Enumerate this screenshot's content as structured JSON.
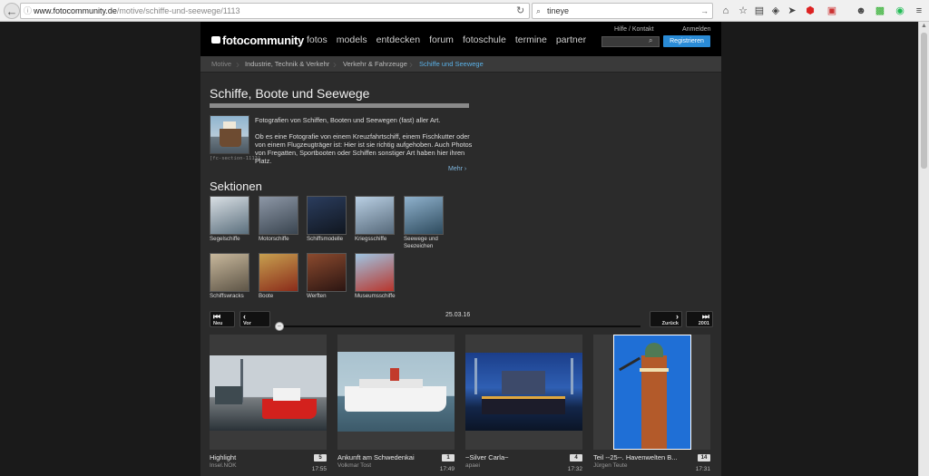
{
  "browser": {
    "url_host": "www.fotocommunity.de",
    "url_path": "/motive/schiffe-und-seewege/1113",
    "search_value": "tineye"
  },
  "header": {
    "logo": "fotocommunity",
    "nav": [
      "fotos",
      "models",
      "entdecken",
      "forum",
      "fotoschule",
      "termine",
      "partner"
    ],
    "help": "Hilfe / Kontakt",
    "login": "Anmelden",
    "register": "Registrieren"
  },
  "breadcrumb": [
    "Motive",
    "Industrie, Technik & Verkehr",
    "Verkehr & Fahrzeuge",
    "Schiffe und Seewege"
  ],
  "page": {
    "title": "Schiffe, Boote und Seewege",
    "thumb_caption": "[fc-section-1113]",
    "intro_1": "Fotografien von Schiffen, Booten und Seewegen (fast) aller Art.",
    "intro_2": "Ob es eine Fotografie von einem Kreuzfahrtschiff, einem Fischkutter oder von einem Flugzeugträger ist: Hier ist sie richtig aufgehoben. Auch Photos von Fregatten, Sportbooten oder Schiffen sonstiger Art haben hier ihren Platz.",
    "more": "Mehr ›"
  },
  "sections": {
    "heading": "Sektionen",
    "items": [
      {
        "label": "Segelschiffe",
        "color_a": "#d9dfe4",
        "color_b": "#5b6f7d"
      },
      {
        "label": "Motorschiffe",
        "color_a": "#8d97a6",
        "color_b": "#3a4550"
      },
      {
        "label": "Schiffsmodelle",
        "color_a": "#2b3d5e",
        "color_b": "#10161f"
      },
      {
        "label": "Kriegsschiffe",
        "color_a": "#b9cfe3",
        "color_b": "#56697a"
      },
      {
        "label": "Seewege und Seezeichen",
        "color_a": "#8fb1cc",
        "color_b": "#2e4b5e"
      },
      {
        "label": "Schiffswracks",
        "color_a": "#c8b89c",
        "color_b": "#5d5446"
      },
      {
        "label": "Boote",
        "color_a": "#c7a04f",
        "color_b": "#8a2b1a"
      },
      {
        "label": "Werften",
        "color_a": "#8b4a2e",
        "color_b": "#2b1512"
      },
      {
        "label": "Museumsschiffe",
        "color_a": "#9fc5e2",
        "color_b": "#b8352c"
      }
    ]
  },
  "slider": {
    "newest": "Neu",
    "prev": "Vor",
    "next": "Zurück",
    "oldest": "2001",
    "date": "25.03.16"
  },
  "photos": [
    {
      "title": "Highlight",
      "author": "Insel.NOK",
      "count": "5",
      "time": "17:55"
    },
    {
      "title": "Ankunft am Schwedenkai",
      "author": "Volkmar Tost",
      "count": "1",
      "time": "17:49"
    },
    {
      "title": "~Silver Carla~",
      "author": "apaei",
      "count": "4",
      "time": "17:32"
    },
    {
      "title": "Teil --25--. Havenwelten B...",
      "author": "Jürgen Teute",
      "count": "14",
      "time": "17:31"
    }
  ],
  "colors": {
    "accent": "#2a8bd6",
    "breadcrumb_active": "#5ab0e6"
  }
}
